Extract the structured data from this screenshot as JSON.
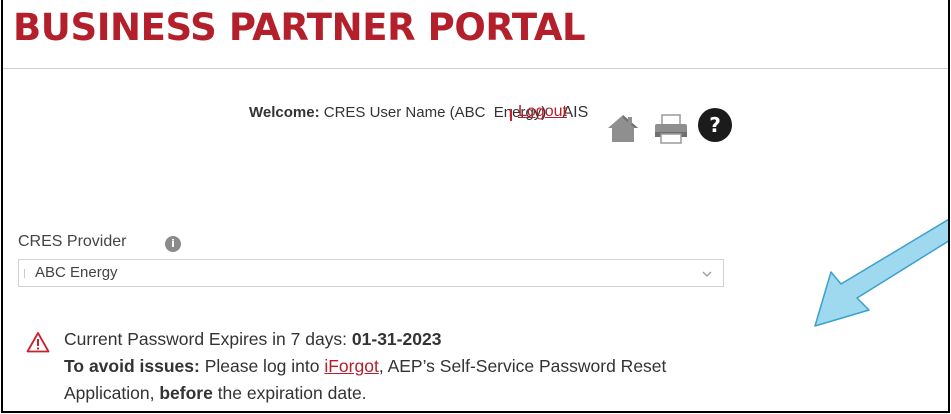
{
  "header": {
    "title": "BUSINESS PARTNER PORTAL"
  },
  "user_bar": {
    "welcome_label": "Welcome:",
    "user_name": "CRES User Name (ABC  Energy)",
    "ais": "AIS",
    "logout": "Logout",
    "icons": [
      "home-icon",
      "print-icon",
      "help-icon"
    ],
    "help_glyph": "?"
  },
  "provider": {
    "label": "CRES Provider",
    "info_glyph": "i",
    "selected": "ABC Energy"
  },
  "notice": {
    "line1_prefix": "Current Password Expires in 7 days: ",
    "line1_date": "01-31-2023",
    "line2_bold": "To avoid issues:",
    "line2_text": " Please log into ",
    "link": "iForgot",
    "line2_rest": ", AEP’s Self-Service Password Reset",
    "line3_start": "Application, ",
    "line3_bold": "before",
    "line3_end": " the expiration date."
  },
  "colors": {
    "brand_red": "#b3202b",
    "arrow_blue": "#9fd9ef"
  }
}
